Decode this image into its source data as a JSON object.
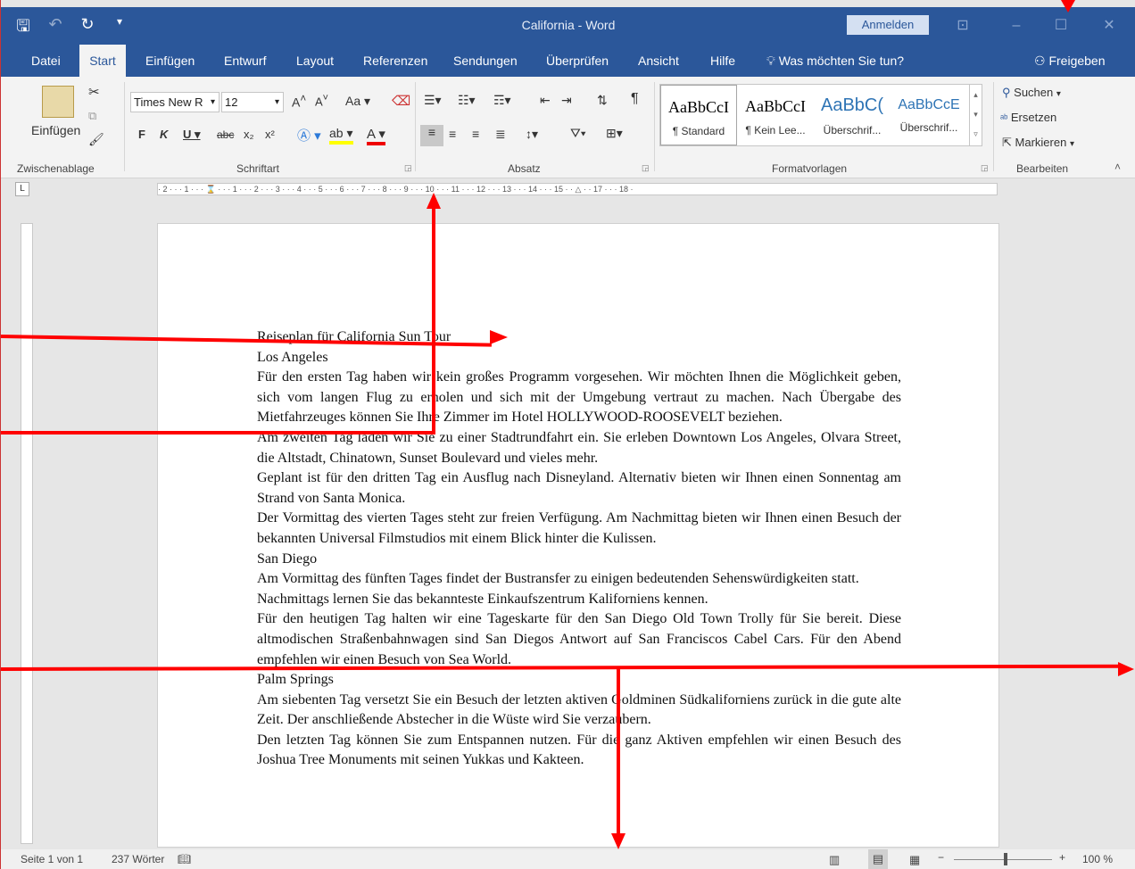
{
  "window": {
    "title": "California  -  Word",
    "signin": "Anmelden"
  },
  "tabs": [
    {
      "label": "Datei"
    },
    {
      "label": "Start"
    },
    {
      "label": "Einfügen"
    },
    {
      "label": "Entwurf"
    },
    {
      "label": "Layout"
    },
    {
      "label": "Referenzen"
    },
    {
      "label": "Sendungen"
    },
    {
      "label": "Überprüfen"
    },
    {
      "label": "Ansicht"
    },
    {
      "label": "Hilfe"
    }
  ],
  "tellme": "Was möchten Sie tun?",
  "share": "Freigeben",
  "ribbon": {
    "paste_label": "Einfügen",
    "font_name": "Times New R",
    "font_size": "12",
    "groups": {
      "clipboard": "Zwischenablage",
      "font": "Schriftart",
      "paragraph": "Absatz",
      "styles": "Formatvorlagen",
      "editing": "Bearbeiten"
    },
    "styles": [
      {
        "preview": "AaBbCcI",
        "name": "¶ Standard"
      },
      {
        "preview": "AaBbCcI",
        "name": "¶ Kein Lee..."
      },
      {
        "preview": "AaBbC(",
        "name": "Überschrif..."
      },
      {
        "preview": "AaBbCcE",
        "name": "Überschrif..."
      }
    ],
    "editing": {
      "search": "Suchen",
      "replace": "Ersetzen",
      "select": "Markieren"
    }
  },
  "ruler_text": "· 2 · · · 1 · · · ⌛ · · · 1 · · · 2 · · · 3 · · · 4 · · · 5 · · · 6 · · · 7 · · · 8 · · · 9 · · · 10 · · · 11 · · · 12 · · · 13 · · · 14 · · · 15 · · △ · · 17 · · · 18 ·",
  "document": {
    "paragraphs": [
      "Reiseplan für California Sun Tour",
      "Los Angeles",
      "Für den ersten Tag haben wir kein großes Programm vorgesehen. Wir möchten Ihnen die Möglichkeit geben, sich vom langen Flug zu erholen und sich mit der Umgebung vertraut zu machen. Nach Übergabe des Mietfahrzeuges können Sie Ihre Zimmer im Hotel HOLLYWOOD-ROOSEVELT beziehen.",
      "Am zweiten Tag laden wir Sie zu einer Stadtrundfahrt ein. Sie erleben Downtown Los Angeles, Olvara Street, die Altstadt, Chinatown, Sunset Boulevard und vieles mehr.",
      "Geplant ist für den dritten Tag ein Ausflug nach Disneyland. Alternativ bieten wir Ihnen einen Sonnentag am Strand von Santa Monica.",
      "Der Vormittag des vierten Tages steht zur freien Verfügung. Am Nachmittag bieten wir Ihnen einen Besuch der bekannten Universal Filmstudios mit einem Blick hinter die Kulissen.",
      "San Diego",
      "Am Vormittag des fünften Tages findet der Bustransfer zu einigen bedeutenden Sehenswürdigkeiten statt. Nachmittags lernen Sie das bekannteste Einkaufszentrum Kaliforniens kennen.",
      "Für den heutigen Tag halten wir eine Tageskarte für den San Diego Old Town Trolly für Sie bereit. Diese altmodischen Straßenbahnwagen sind San Diegos Antwort auf San Franciscos Cabel Cars. Für den Abend empfehlen wir einen Besuch von Sea World.",
      "Palm Springs",
      "Am siebenten Tag versetzt Sie ein Besuch der letzten aktiven Goldminen Südkaliforniens zurück in die gute alte Zeit. Der anschließende Abstecher in die Wüste wird Sie verzaubern.",
      "Den letzten Tag können Sie zum Entspannen nutzen. Für die ganz Aktiven empfehlen wir einen Besuch des Joshua Tree Monuments mit seinen Yukkas und Kakteen."
    ]
  },
  "status": {
    "page": "Seite 1 von 1",
    "words": "237 Wörter",
    "zoom": "100 %"
  },
  "colors": {
    "accent": "#2b579a",
    "annotation": "#ff0000"
  }
}
